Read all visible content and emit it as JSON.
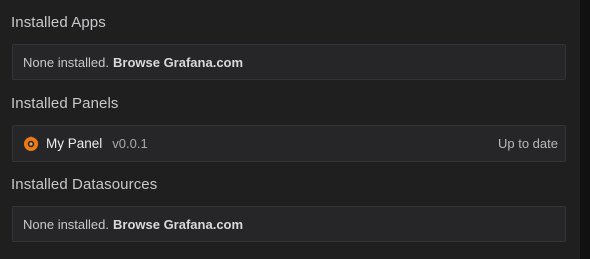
{
  "sections": {
    "apps": {
      "title": "Installed Apps",
      "empty_text": "None installed.",
      "browse_label": "Browse Grafana.com"
    },
    "panels": {
      "title": "Installed Panels",
      "items": [
        {
          "icon": "grafana-plugin-icon",
          "name": "My Panel",
          "version": "v0.0.1",
          "status": "Up to date"
        }
      ]
    },
    "datasources": {
      "title": "Installed Datasources",
      "empty_text": "None installed.",
      "browse_label": "Browse Grafana.com"
    }
  },
  "colors": {
    "background": "#1f1f20",
    "card": "#262628",
    "icon_accent": "#eb7b18"
  }
}
